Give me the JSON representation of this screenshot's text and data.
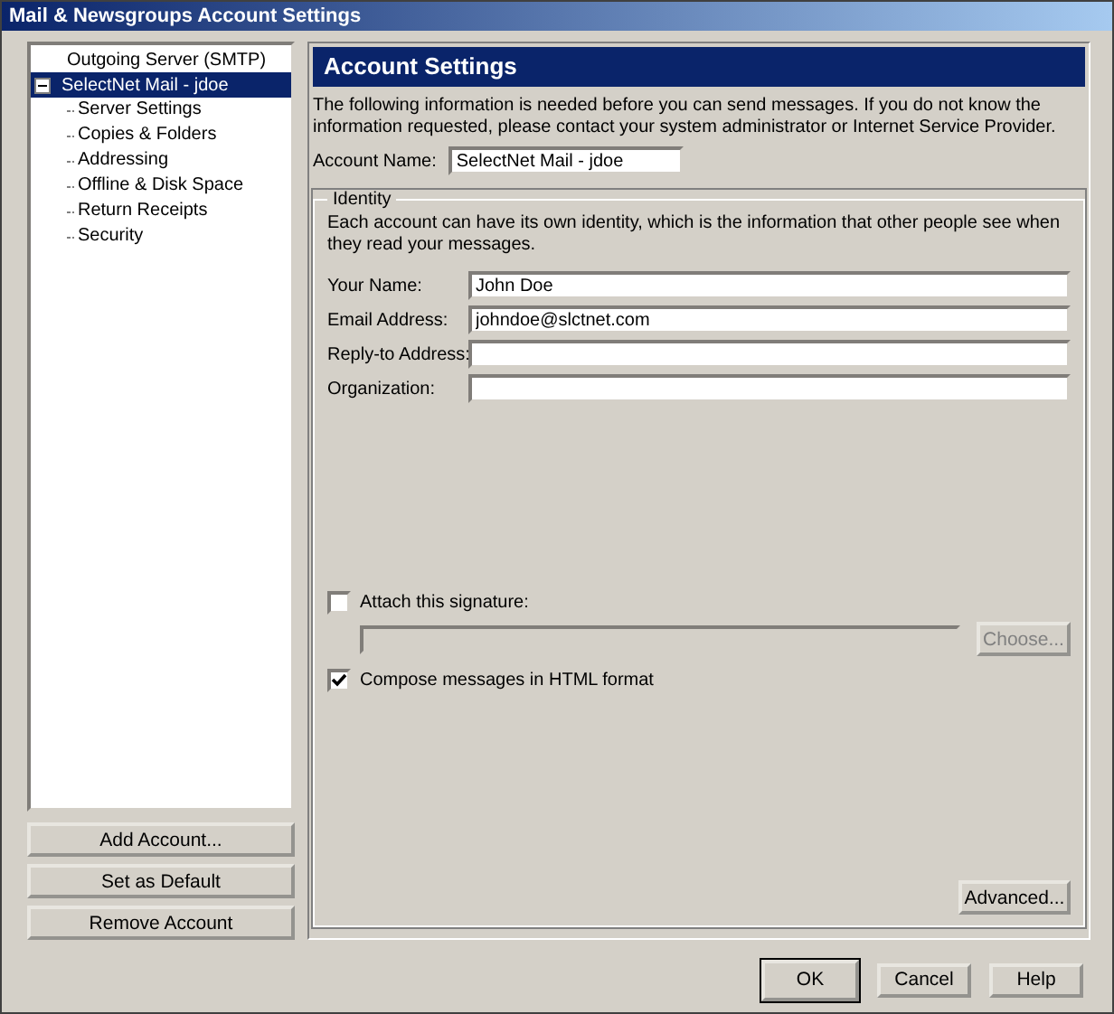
{
  "window": {
    "title": "Mail & Newsgroups Account Settings"
  },
  "tree": [
    {
      "label": "Outgoing Server (SMTP)",
      "selected": false
    },
    {
      "label": "SelectNet Mail - jdoe",
      "selected": true,
      "expanded": true,
      "children": [
        {
          "label": "Server Settings",
          "selected": false
        },
        {
          "label": "Copies & Folders",
          "selected": false
        },
        {
          "label": "Addressing",
          "selected": false
        },
        {
          "label": "Offline & Disk Space",
          "selected": false
        },
        {
          "label": "Return Receipts",
          "selected": false
        },
        {
          "label": "Security",
          "selected": false
        }
      ]
    }
  ],
  "account_buttons": [
    "Add Account...",
    "Set as Default",
    "Remove Account"
  ],
  "panel": {
    "title": "Account Settings",
    "description": "The following information is needed before you can send messages. If you do not know the information requested, please contact your system administrator or Internet Service Provider.",
    "account_name": {
      "label": "Account Name:",
      "value": "SelectNet Mail - jdoe"
    },
    "identity": {
      "legend": "Identity",
      "description": "Each account can have its own identity, which is the information that other people see when they read your messages.",
      "fields": [
        {
          "label": "Your Name:",
          "value": "John Doe"
        },
        {
          "label": "Email Address:",
          "value": "johndoe@slctnet.com"
        },
        {
          "label": "Reply-to Address:"
        },
        {
          "label": "Organization:"
        }
      ],
      "signature": {
        "label": "Attach this signature:",
        "checked": false,
        "choose_button": "Choose...",
        "disabled": true
      },
      "html_format": {
        "label": "Compose messages in HTML format",
        "checked": true
      },
      "advanced_button": "Advanced..."
    }
  },
  "dialog_buttons": [
    {
      "label": "OK",
      "default": true
    },
    {
      "label": "Cancel",
      "default": false
    },
    {
      "label": "Help",
      "default": false
    }
  ]
}
